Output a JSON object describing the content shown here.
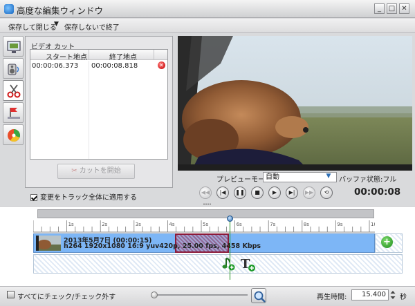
{
  "window": {
    "title": "高度な編集ウィンドウ",
    "controls": {
      "minimize": "_",
      "maximize": "□",
      "close": "✕"
    }
  },
  "menu": {
    "save_close": "保存して閉じる",
    "dropdown_arrow": "▼",
    "close_no_save": "保存しないで終了"
  },
  "tools": [
    {
      "name": "video-tool",
      "icon": "monitor-icon"
    },
    {
      "name": "audio-tool",
      "icon": "speaker-icon"
    },
    {
      "name": "cut-tool",
      "icon": "scissors-icon",
      "active": true
    },
    {
      "name": "marker-tool",
      "icon": "flag-icon"
    },
    {
      "name": "effect-tool",
      "icon": "effect-wheel-icon"
    }
  ],
  "cut_panel": {
    "title": "ビデオ カット",
    "col_start": "スタート地点",
    "col_end": "終了地点",
    "rows": [
      {
        "start": "00:00:06.373",
        "end": "00:00:08.818"
      }
    ],
    "start_cut_label": "カットを開始",
    "apply_all_label": "変更をトラック全体に適用する",
    "apply_all_checked": true
  },
  "preview": {
    "mode_label": "プレビューモード:",
    "mode_value": "自動",
    "buffer_label": "バッファ状態:フル",
    "time": "00:00:08",
    "buttons": [
      {
        "name": "rewind-button",
        "glyph": "◀◀",
        "enabled": false
      },
      {
        "name": "prev-button",
        "glyph": "|◀",
        "enabled": true
      },
      {
        "name": "pause-button",
        "glyph": "❚❚",
        "enabled": true
      },
      {
        "name": "stop-button",
        "glyph": "■",
        "enabled": true
      },
      {
        "name": "play-button",
        "glyph": "▶",
        "enabled": true
      },
      {
        "name": "next-button",
        "glyph": "▶|",
        "enabled": true
      },
      {
        "name": "forward-button",
        "glyph": "▶▶",
        "enabled": false
      },
      {
        "name": "loop-button",
        "glyph": "⟲",
        "enabled": true
      }
    ]
  },
  "timeline": {
    "ruler_labels": [
      "1s",
      "2s",
      "3s",
      "4s",
      "5s",
      "6s",
      "7s",
      "8s",
      "9s",
      "10s",
      "11s",
      "12s",
      "13s",
      "14s"
    ],
    "clip_title": "2013年5月7日 (00:00:15)",
    "clip_info": "h264 1920x1080 16:9 yuv420p, 25.00 fps, 4458 Kbps",
    "playhead_seconds": 8,
    "duration_seconds": 15,
    "cut_start_seconds": 6.373,
    "cut_end_seconds": 8.818,
    "add_clip_glyph": "+"
  },
  "bottom": {
    "check_all_label": "すべてにチェック/チェック外す",
    "playtime_label": "再生時間:",
    "playtime_value": "15.400",
    "playtime_unit": "秒"
  },
  "colors": {
    "clip_fill": "#7db6f6",
    "cut_border": "#8a1a3a",
    "playhead": "#1c8c1c"
  }
}
